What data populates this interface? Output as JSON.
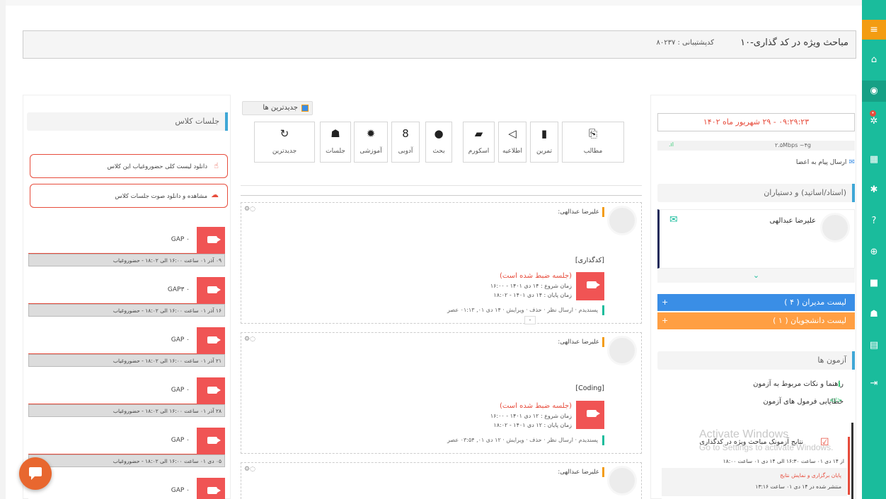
{
  "header": {
    "title": "مباحث ویژه در کد گذاری-۱۰",
    "code": "کدپشتیبانی : ۸۰۲۳۷"
  },
  "sidebar": {
    "menu_icon": "≡",
    "icons": [
      "home-icon",
      "chat-icon",
      "cogs-icon",
      "calendar-icon",
      "settings-icon",
      "help-icon",
      "globe-icon",
      "video-icon",
      "users-icon",
      "grades-icon",
      "logout-icon"
    ]
  },
  "left": {
    "heading": "جلسات کلاس",
    "download_attendance": "دانلود لیست کلی حضوروغیاب این کلاس",
    "download_audio": "مشاهده و دانلود صوت جلسات کلاس",
    "sessions": [
      {
        "label": "GAP ۰",
        "info": "۰۹ آذر ۰۱ ساعت ۱۶:۰۰ الی ۱۸:۰۲ - حضوروغیاب"
      },
      {
        "label": "GAP۳ ۰",
        "info": "۱۶ آذر ۰۱ ساعت ۱۶:۰۰ الی ۱۸:۰۲ - حضوروغیاب"
      },
      {
        "label": "GAP ۰",
        "info": "۲۱ آذر ۰۱ ساعت ۱۶:۰۰ الی ۱۸:۰۲ - حضوروغیاب"
      },
      {
        "label": "GAP ۰",
        "info": "۲۸ آذر ۰۱ ساعت ۱۶:۰۰ الی ۱۸:۰۲ - حضوروغیاب"
      },
      {
        "label": "GAP ۰",
        "info": "۰۵ دی ۰۱ ساعت ۱۶:۰۰ الی ۱۸:۰۲ - حضوروغیاب"
      },
      {
        "label": "GAP ۰",
        "info": ""
      }
    ]
  },
  "middle": {
    "latest_tab": "جدیدترین ها",
    "tools": [
      {
        "icon": "⎘",
        "label": "مطالب"
      },
      {
        "icon": "▮",
        "label": "تمرین"
      },
      {
        "icon": "◁",
        "label": "اطلاعیه"
      },
      {
        "icon": "▰",
        "label": "اسکورم"
      },
      {
        "icon": "●",
        "label": "بحث"
      },
      {
        "icon": "8",
        "label": "آدوبی"
      },
      {
        "icon": "✹",
        "label": "آموزشی"
      },
      {
        "icon": "☗",
        "label": "جلسات"
      },
      {
        "icon": "↻",
        "label": "جدیدترین"
      }
    ],
    "posts": [
      {
        "author": "علیرضا عبدالهی:",
        "title": "[کدگذاری]",
        "status": "(جلسه ضبط شده است)",
        "start": "زمان شروع : ۱۴ دی ۱۴۰۱ - ۱۶:۰۰",
        "end": "زمان پایان : ۱۴ دی ۱۴۰۱ - ۱۸:۰۲",
        "actions": "پسندیدم · ارسال نظر · حذف · ویرایش · ۱۴ دی ۰۱, ۰۱:۱۳ عصر"
      },
      {
        "author": "علیرضا عبدالهی:",
        "title": "[Coding]",
        "status": "(جلسه ضبط شده است)",
        "start": "زمان شروع : ۱۲ دی ۱۴۰۱ - ۱۶:۰۰",
        "end": "زمان پایان : ۱۲ دی ۱۴۰۱ - ۱۸:۰۲",
        "actions": "پسندیدم · ارسال نظر · حذف · ویرایش · ۱۲ دی ۰۱, ۰۳:۵۴ عصر"
      },
      {
        "author": "علیرضا عبدالهی:"
      }
    ]
  },
  "right": {
    "datetime": "۰۹:۲۹:۲۳ - ۲۹ شهریور ماه ۱۴۰۲",
    "network": "۲.۵Mbps ~۴g",
    "send_message": "ارسال پیام به اعضا",
    "staff_heading": "(استاد/اساتید) و دستیاران",
    "teacher_name": "علیرضا عبدالهی",
    "managers_list": "لیست مدیران ( ۴ )",
    "students_list": "لیست دانشجویان ( ۱ )",
    "exams_heading": "آزمون ها",
    "exam_guide": "راهنما و نکات مربوط به آزمون",
    "exam_formula": "خطایابی فرمول های آزمون",
    "result_title": "نتایج آزمونک مباحث ویژه در کدگذاری",
    "result_time": "از ۱۴ دی ۰۱ ساعت ۱۶:۳۰ الی ۱۴ دی ۰۱ ساعت ۱۸:۰۰",
    "result_end": "پایان برگزاری و نمایش نتایج",
    "result_published": "منتشر شده در ۱۴ دی ۰۱ ساعت ۱۳:۱۶"
  },
  "watermark": {
    "line1": "Activate Windows",
    "line2": "Go to Settings to activate Windows."
  },
  "colors": {
    "sidebar": "#1abc9c",
    "accent_orange": "#f39c12",
    "red": "#f05454",
    "blue_list": "#3a8ee6",
    "orange_list": "#ff9f43"
  }
}
